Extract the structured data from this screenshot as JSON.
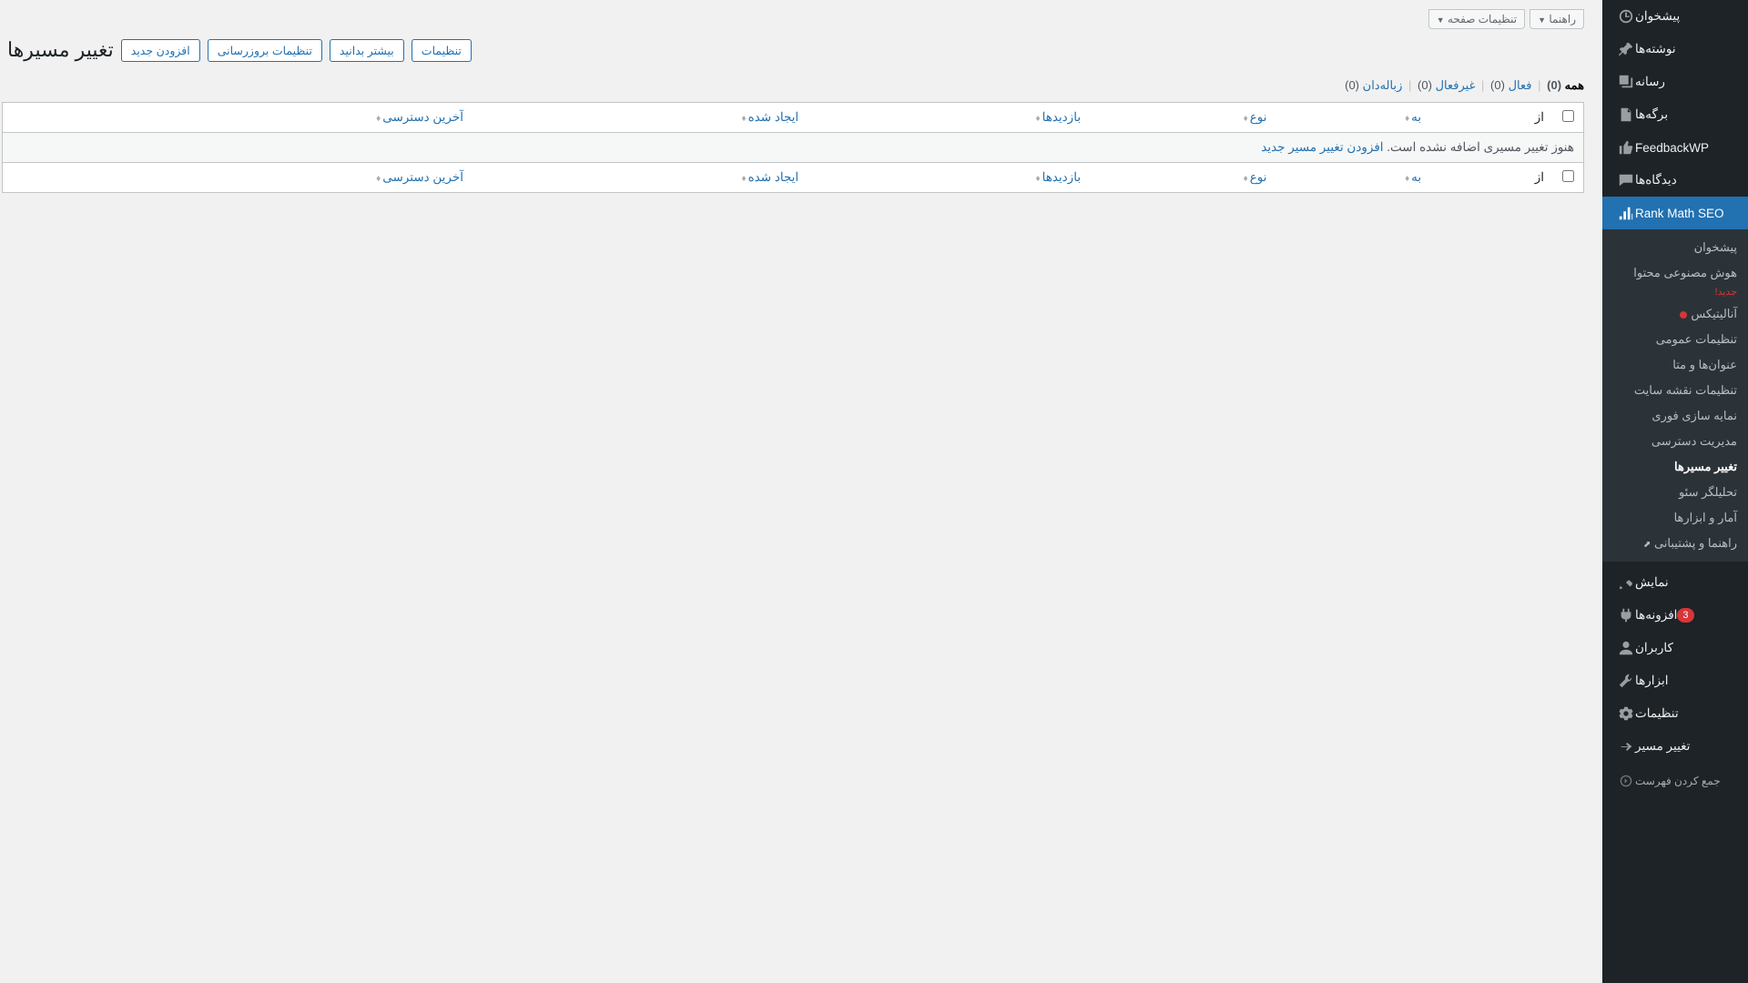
{
  "sidebar": {
    "items": [
      {
        "icon": "dashboard",
        "label": "پیشخوان"
      },
      {
        "icon": "pin",
        "label": "نوشته‌ها"
      },
      {
        "icon": "media",
        "label": "رسانه"
      },
      {
        "icon": "page",
        "label": "برگه‌ها"
      },
      {
        "icon": "thumbs",
        "label": "FeedbackWP"
      },
      {
        "icon": "comment",
        "label": "دیدگاه‌ها"
      },
      {
        "icon": "rankmath",
        "label": "Rank Math SEO",
        "active": true
      }
    ],
    "submenu": [
      {
        "label": "پیشخوان"
      },
      {
        "label": "هوش مصنوعی محتوا",
        "sub": "جدید!"
      },
      {
        "label": "آنالیتیکس",
        "dot": true
      },
      {
        "label": "تنظیمات عمومی"
      },
      {
        "label": "عنوان‌ها و متا"
      },
      {
        "label": "تنظیمات نقشه سایت"
      },
      {
        "label": "نمایه سازی فوری"
      },
      {
        "label": "مدیریت دسترسی"
      },
      {
        "label": "تغییر مسیرها",
        "current": true
      },
      {
        "label": "تحلیلگر سئو"
      },
      {
        "label": "آمار و ابزارها"
      },
      {
        "label": "راهنما و پشتیبانی",
        "ext": true
      }
    ],
    "items2": [
      {
        "icon": "appearance",
        "label": "نمایش"
      },
      {
        "icon": "plugin",
        "label": "افزونه‌ها",
        "badge": "3"
      },
      {
        "icon": "users",
        "label": "کاربران"
      },
      {
        "icon": "tools",
        "label": "ابزارها"
      },
      {
        "icon": "settings",
        "label": "تنظیمات"
      },
      {
        "icon": "redirect",
        "label": "تغییر مسیر"
      }
    ],
    "collapse": "جمع کردن فهرست"
  },
  "topbar": {
    "screen_options": "تنظیمات صفحه",
    "help": "راهنما"
  },
  "header": {
    "title": "تغییر مسیرها",
    "btn_addnew": "افزودن جدید",
    "btn_update": "تنظیمات بروزرسانی",
    "btn_learn": "بیشتر بدانید",
    "btn_settings": "تنظیمات"
  },
  "filters": {
    "all": {
      "label": "همه",
      "count": "(0)"
    },
    "active": {
      "label": "فعال",
      "count": "(0)"
    },
    "inactive": {
      "label": "غیرفعال",
      "count": "(0)"
    },
    "trash": {
      "label": "زباله‌دان",
      "count": "(0)"
    }
  },
  "table": {
    "col_from": "از",
    "col_to": "به",
    "col_type": "نوع",
    "col_hits": "بازدیدها",
    "col_created": "ایجاد شده",
    "col_last": "آخرین دسترسی",
    "empty_msg": "هنوز تغییر مسیری اضافه نشده است. ",
    "empty_link": "افزودن تغییر مسیر جدید"
  }
}
